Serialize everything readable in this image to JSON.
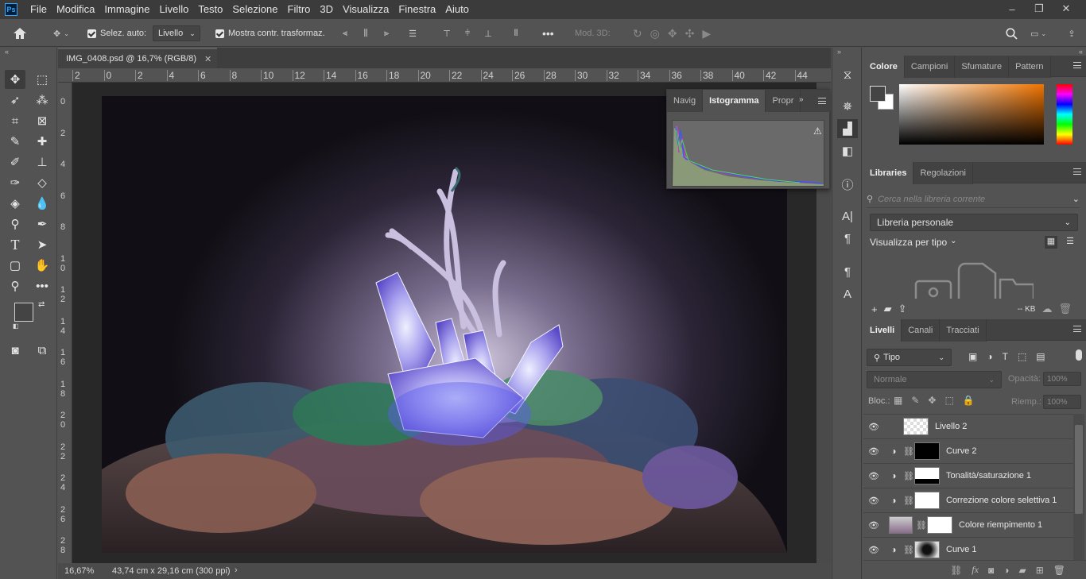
{
  "app": {
    "logo": "Ps"
  },
  "menu": [
    "File",
    "Modifica",
    "Immagine",
    "Livello",
    "Testo",
    "Selezione",
    "Filtro",
    "3D",
    "Visualizza",
    "Finestra",
    "Aiuto"
  ],
  "options": {
    "auto_select_label": "Selez. auto:",
    "auto_select_value": "Livello",
    "show_transform_label": "Mostra contr. trasformaz.",
    "mode3d_label": "Mod. 3D:",
    "more": "•••"
  },
  "document": {
    "tab_title": "IMG_0408.psd @ 16,7% (RGB/8)",
    "zoom": "16,67%",
    "size_info": "43,74 cm x 29,16 cm (300 ppi)"
  },
  "ruler": {
    "top_labels": [
      "2",
      "0",
      "2",
      "4",
      "6",
      "8",
      "10",
      "12",
      "14",
      "16",
      "18",
      "20",
      "22",
      "24",
      "26",
      "28",
      "30",
      "32",
      "34",
      "36",
      "38",
      "40",
      "42",
      "44"
    ],
    "left_labels": [
      "0",
      "2",
      "4",
      "6",
      "8",
      "1\n0",
      "1\n2",
      "1\n4",
      "1\n6",
      "1\n8",
      "2\n0",
      "2\n2",
      "2\n4",
      "2\n6",
      "2\n8"
    ]
  },
  "histogram_panel": {
    "tabs": [
      "Navig",
      "Istogramma",
      "Propr"
    ],
    "active_tab": "Istogramma"
  },
  "color_panel": {
    "tabs": [
      "Colore",
      "Campioni",
      "Sfumature",
      "Pattern"
    ],
    "foreground": "#444444",
    "background": "#ffffff"
  },
  "libraries_panel": {
    "tabs": [
      "Libraries",
      "Regolazioni"
    ],
    "search_placeholder": "Cerca nella libreria corrente",
    "library": "Libreria personale",
    "view_by": "Visualizza per tipo",
    "size": "-- KB"
  },
  "layers_panel": {
    "tabs": [
      "Livelli",
      "Canali",
      "Tracciati"
    ],
    "filter": "Tipo",
    "blend_mode": "Normale",
    "opacity_label": "Opacità:",
    "opacity_value": "100%",
    "lock_label": "Bloc.:",
    "fill_label": "Riemp.:",
    "fill_value": "100%",
    "layers": [
      {
        "name": "Livello 2"
      },
      {
        "name": "Curve 2"
      },
      {
        "name": "Tonalità/saturazione 1"
      },
      {
        "name": "Correzione colore selettiva 1"
      },
      {
        "name": "Colore riempimento 1"
      },
      {
        "name": "Curve 1"
      }
    ]
  }
}
